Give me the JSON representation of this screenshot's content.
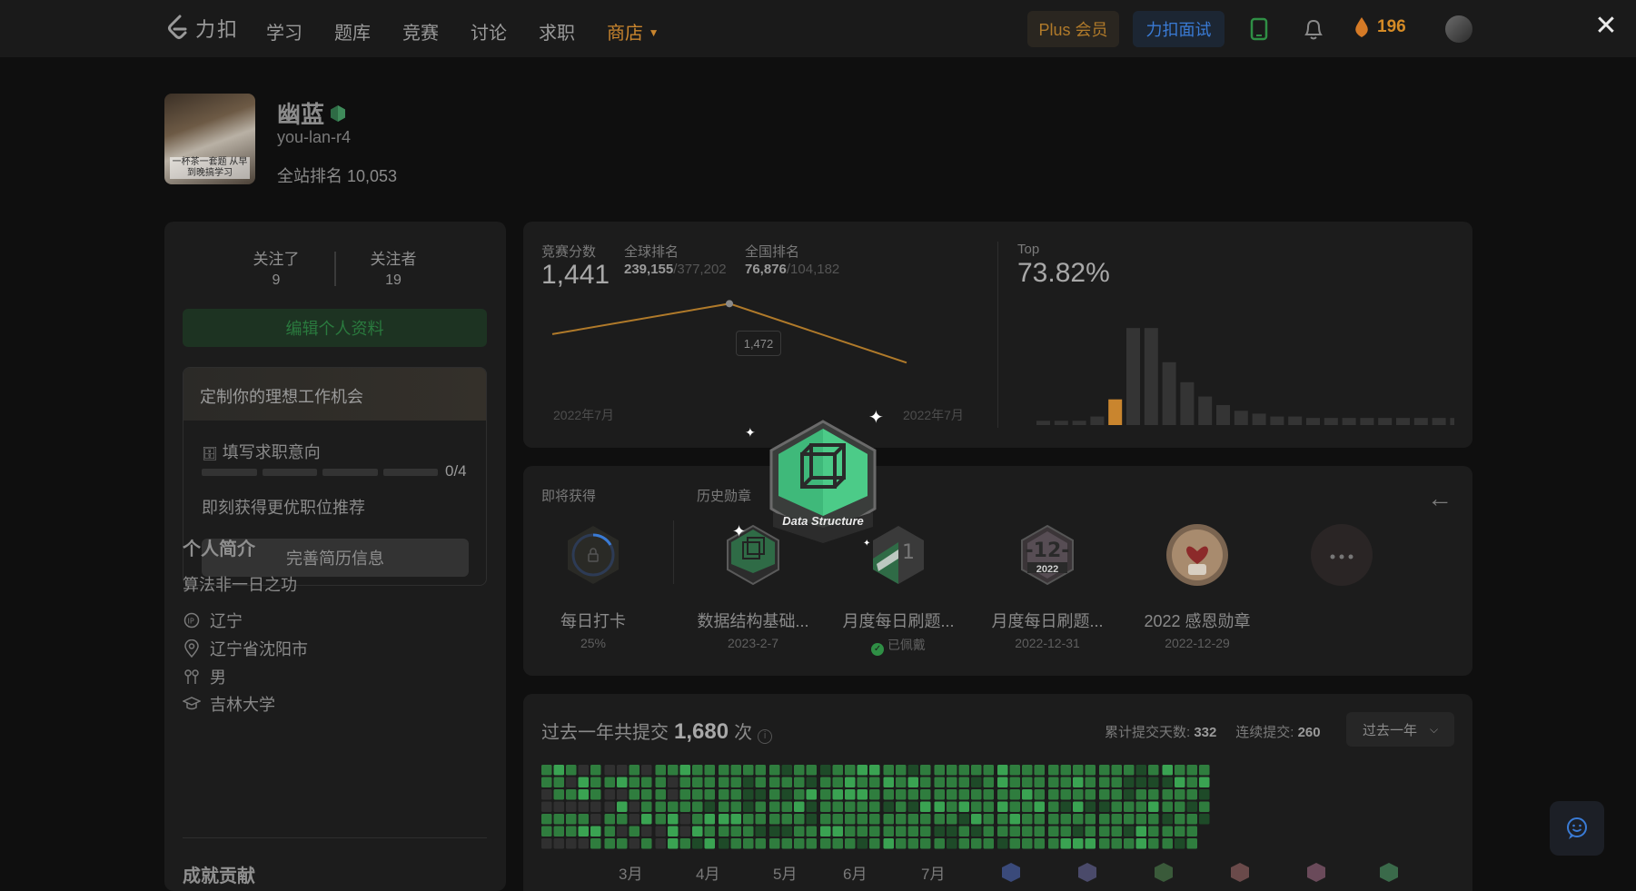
{
  "nav": {
    "logo": "力扣",
    "items": [
      "学习",
      "题库",
      "竞赛",
      "讨论",
      "求职"
    ],
    "store": "商店",
    "plus": "Plus 会员",
    "interview": "力扣面试",
    "coins": "196",
    "close": "✕"
  },
  "profile": {
    "name": "幽蓝",
    "handle": "you-lan-r4",
    "rank_label": "全站排名",
    "rank_value": "10,053",
    "avatar_caption": "一杯茶一套题 从早到晚搞学习"
  },
  "left": {
    "following_label": "关注了",
    "following": "9",
    "followers_label": "关注者",
    "followers": "19",
    "edit": "编辑个人资料",
    "job_title": "定制你的理想工作机会",
    "job_sub": "填写求职意向",
    "job_progress": "0/4",
    "job_progress_value": 0,
    "job_tip": "即刻获得更优职位推荐",
    "resume": "完善简历信息",
    "bio_title": "个人简介",
    "bio": "算法非一日之功",
    "ip": "辽宁",
    "location": "辽宁省沈阳市",
    "gender": "男",
    "school": "吉林大学",
    "achievements_title": "成就贡献"
  },
  "contest": {
    "score_label": "竞赛分数",
    "score": "1,441",
    "global_label": "全球排名",
    "global_rank": "239,155",
    "global_total": "/377,202",
    "national_label": "全国排名",
    "national_rank": "76,876",
    "national_total": "/104,182",
    "top_label": "Top",
    "top_value": "73.82%",
    "tooltip": "1,472",
    "date_start": "2022年7月",
    "date_end": "2022年7月"
  },
  "chart_data": {
    "type": "line",
    "x": [
      "2022年7月",
      "",
      "2022年7月"
    ],
    "series": [
      {
        "values": [
          1441,
          1472,
          1412
        ]
      }
    ],
    "histogram": {
      "type": "bar",
      "values": [
        3,
        3,
        3,
        6,
        18,
        68,
        68,
        44,
        30,
        20,
        14,
        10,
        8,
        6,
        6,
        5,
        5,
        5,
        5,
        5,
        5,
        5,
        5,
        5,
        5
      ],
      "highlight_index": 4
    }
  },
  "badges": {
    "upcoming_label": "即将获得",
    "history_label": "历史勋章",
    "items": [
      {
        "name": "每日打卡",
        "sub": "25%"
      },
      {
        "name": "数据结构基础...",
        "sub": "2023-2-7"
      },
      {
        "name": "月度每日刷题...",
        "sub": "已佩戴"
      },
      {
        "name": "月度每日刷题...",
        "sub": "2022-12-31"
      },
      {
        "name": "2022 感恩勋章",
        "sub": "2022-12-29"
      }
    ],
    "spotlight_text": "Data Structure",
    "badge_12_year": "2022",
    "badge_12_num": "-12-"
  },
  "subs": {
    "title_pre": "过去一年共提交",
    "count": "1,680",
    "title_post": "次",
    "days_label": "累计提交天数:",
    "days": "332",
    "streak_label": "连续提交:",
    "streak": "260",
    "range": "过去一年",
    "months": [
      "3月",
      "4月",
      "5月",
      "6月",
      "7月"
    ]
  },
  "colors": {
    "accent_orange": "#c9852e",
    "green": "#2f7d3e",
    "blue": "#3a7bd5"
  }
}
